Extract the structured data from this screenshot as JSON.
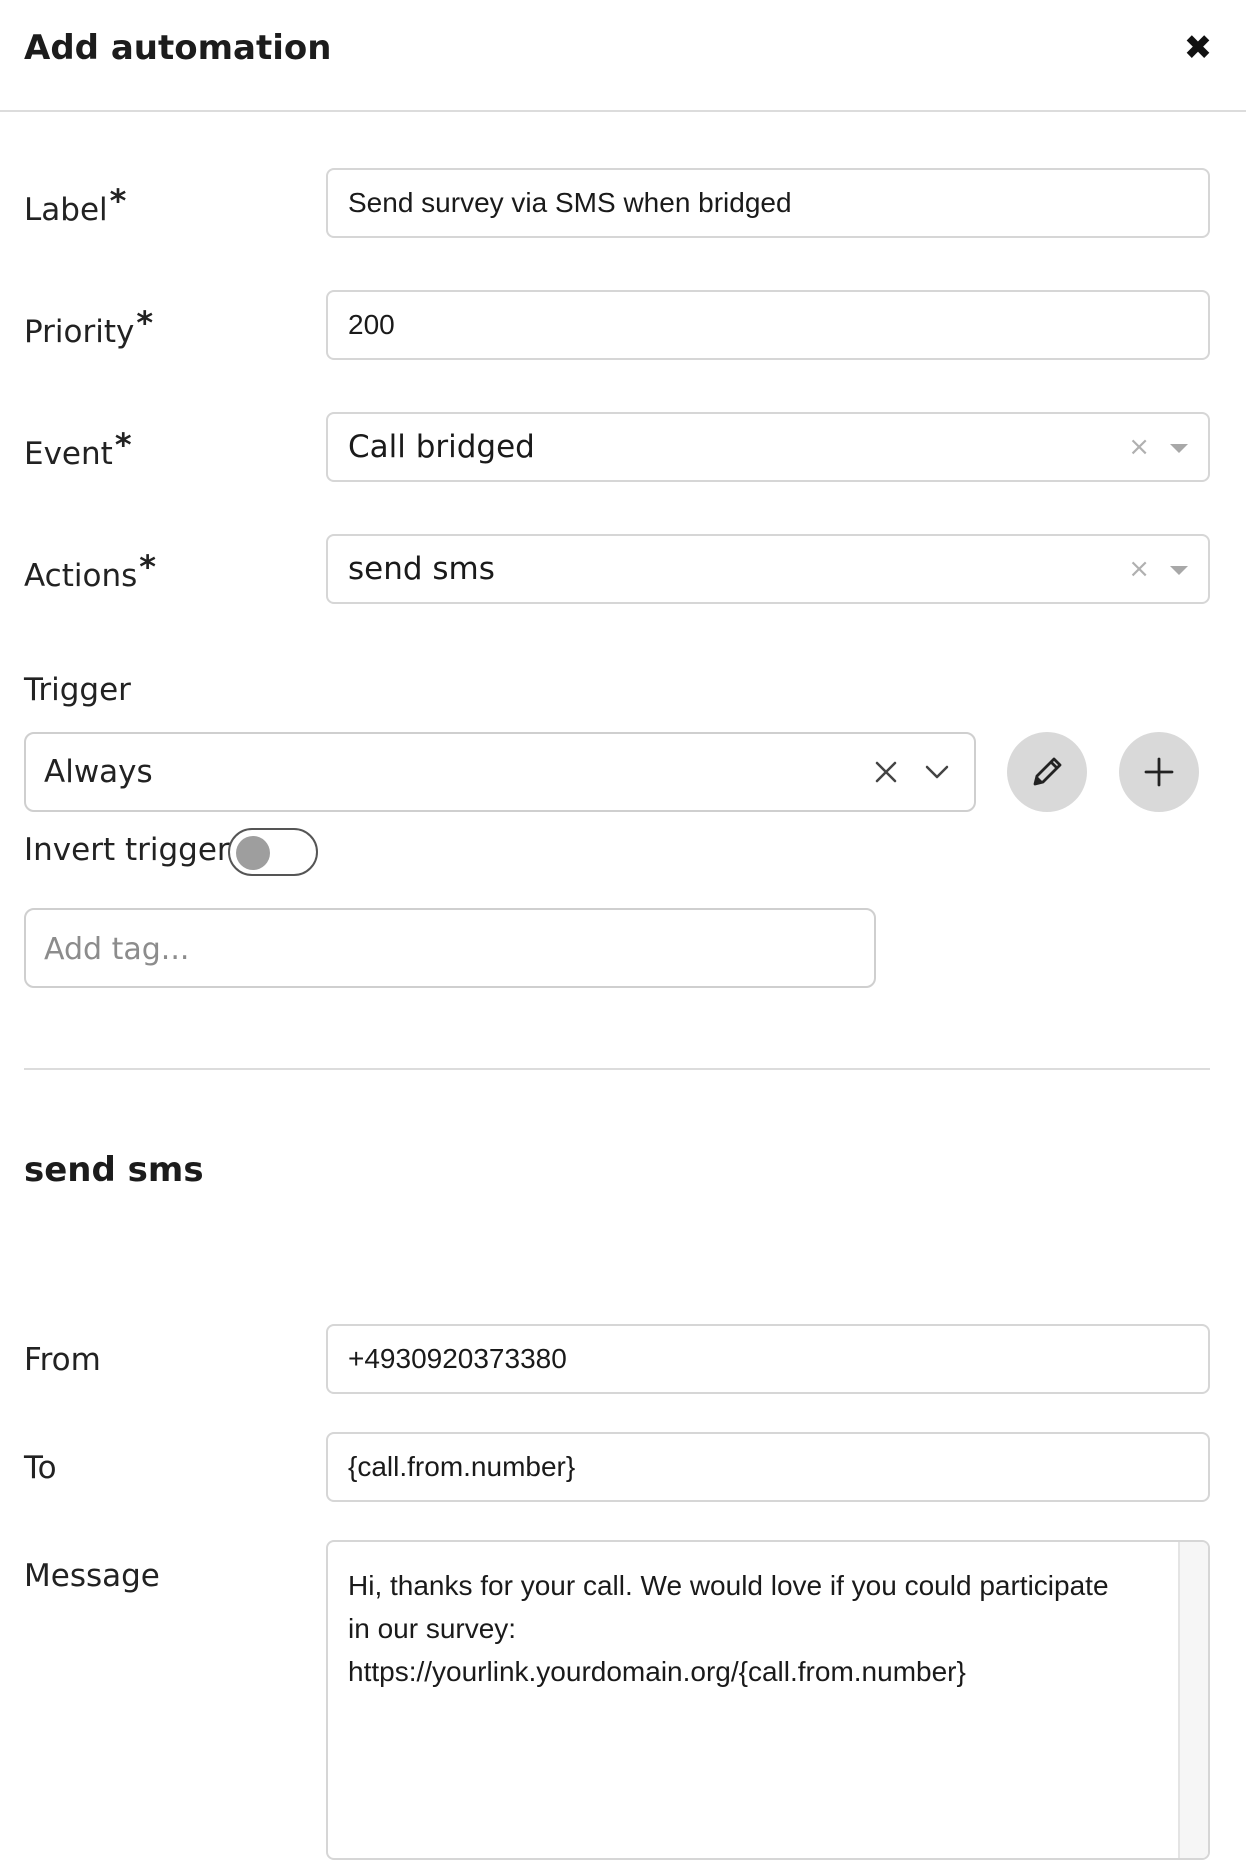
{
  "dialog": {
    "title": "Add automation",
    "close_glyph": "✖"
  },
  "form": {
    "label": {
      "name": "Label",
      "required": "*",
      "value": "Send survey via SMS when bridged"
    },
    "priority": {
      "name": "Priority",
      "required": "*",
      "value": "200"
    },
    "event": {
      "name": "Event",
      "required": "*",
      "value": "Call bridged",
      "clear_glyph": "×"
    },
    "actions": {
      "name": "Actions",
      "required": "*",
      "value": "send sms",
      "clear_glyph": "×"
    }
  },
  "trigger": {
    "label": "Trigger",
    "value": "Always",
    "edit_icon": "pencil-icon",
    "add_icon": "plus-icon",
    "invert_label": "Invert trigger",
    "invert_on": false,
    "tag_placeholder": "Add tag..."
  },
  "sms_section": {
    "title": "send sms",
    "from": {
      "name": "From",
      "value": "+4930920373380"
    },
    "to": {
      "name": "To",
      "value": "{call.from.number}"
    },
    "message": {
      "name": "Message",
      "lines": [
        "Hi, thanks for your call. We would love if you could participate",
        "in our survey:",
        "https://yourlink.yourdomain.org/{call.from.number}"
      ]
    }
  },
  "colors": {
    "border": "#d6d6d6",
    "button_bg": "#d9d9d9",
    "text": "#1f1f1f"
  }
}
